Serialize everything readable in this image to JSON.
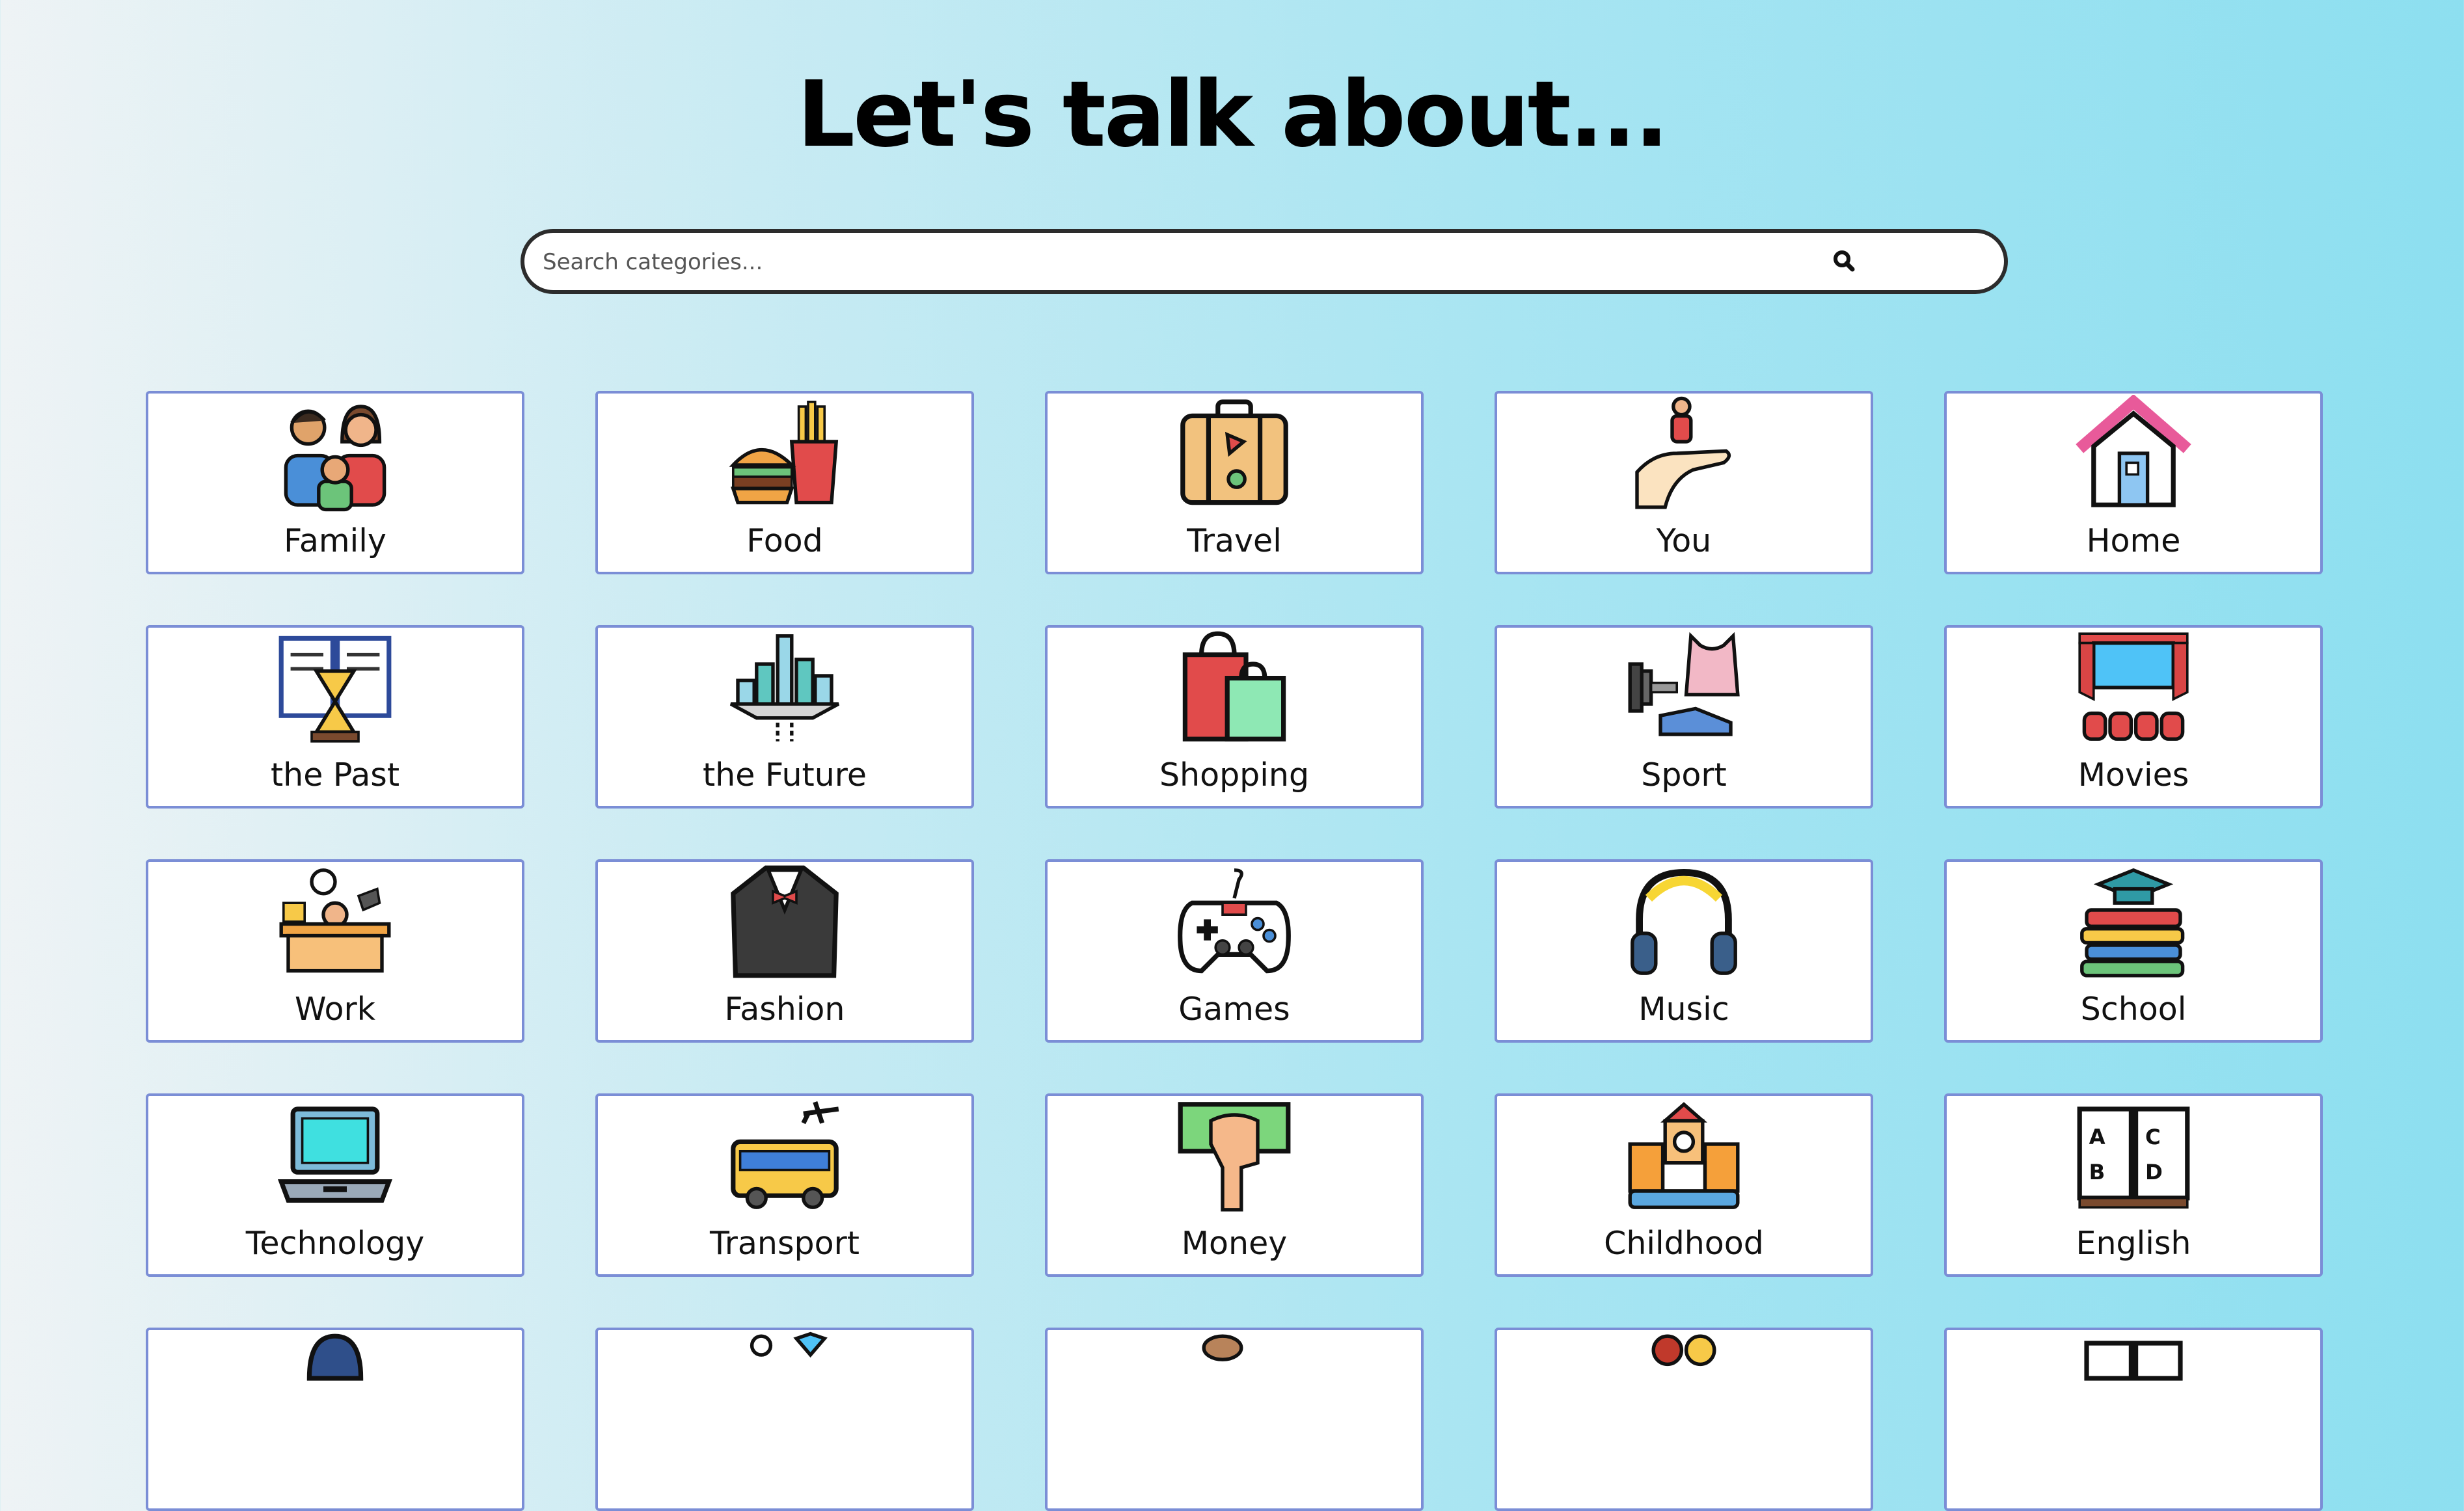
{
  "page": {
    "title": "Let's talk about..."
  },
  "search": {
    "placeholder": "Search categories..."
  },
  "categories": [
    {
      "label": "Family",
      "icon": "family-icon"
    },
    {
      "label": "Food",
      "icon": "burger-fries-icon"
    },
    {
      "label": "Travel",
      "icon": "suitcase-icon"
    },
    {
      "label": "You",
      "icon": "person-in-hand-icon"
    },
    {
      "label": "Home",
      "icon": "house-icon"
    },
    {
      "label": "the Past",
      "icon": "book-hourglass-icon"
    },
    {
      "label": "the Future",
      "icon": "floating-city-icon"
    },
    {
      "label": "Shopping",
      "icon": "shopping-bags-icon"
    },
    {
      "label": "Sport",
      "icon": "dumbbell-jersey-shoe-icon"
    },
    {
      "label": "Movies",
      "icon": "cinema-screen-icon"
    },
    {
      "label": "Work",
      "icon": "office-desk-icon"
    },
    {
      "label": "Fashion",
      "icon": "tuxedo-icon"
    },
    {
      "label": "Games",
      "icon": "gamepad-icon"
    },
    {
      "label": "Music",
      "icon": "headphones-icon"
    },
    {
      "label": "School",
      "icon": "books-graduation-cap-icon"
    },
    {
      "label": "Technology",
      "icon": "laptop-icon"
    },
    {
      "label": "Transport",
      "icon": "bus-plane-icon"
    },
    {
      "label": "Money",
      "icon": "hand-cash-icon"
    },
    {
      "label": "Childhood",
      "icon": "toy-castle-icon"
    },
    {
      "label": "English",
      "icon": "abc-book-icon"
    },
    {
      "label": "",
      "icon": "person-icon"
    },
    {
      "label": "",
      "icon": "wedding-rings-icon"
    },
    {
      "label": "",
      "icon": "animals-icon"
    },
    {
      "label": "",
      "icon": "people-icon"
    },
    {
      "label": "",
      "icon": "open-book-icon"
    }
  ]
}
